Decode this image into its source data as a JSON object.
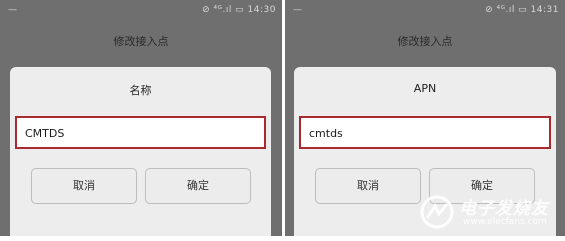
{
  "left": {
    "status": {
      "left": "—",
      "right": "⊘ ⁴ᴳ.ıl ▭ 14:30"
    },
    "screen_title": "修改接入点",
    "dialog": {
      "title": "名称",
      "input_value": "CMTDS",
      "cancel": "取消",
      "ok": "确定"
    }
  },
  "right": {
    "status": {
      "left": "—",
      "right": "⊘ ⁴ᴳ.ıl ▭ 14:31"
    },
    "screen_title": "修改接入点",
    "dialog": {
      "title": "APN",
      "input_value": "cmtds",
      "cancel": "取消",
      "ok": "确定"
    }
  },
  "watermark": {
    "name": "电子发烧友",
    "url": "www.elecfans.com"
  },
  "colors": {
    "highlight": "#a82a31",
    "backdrop": "#6f6f6f"
  }
}
